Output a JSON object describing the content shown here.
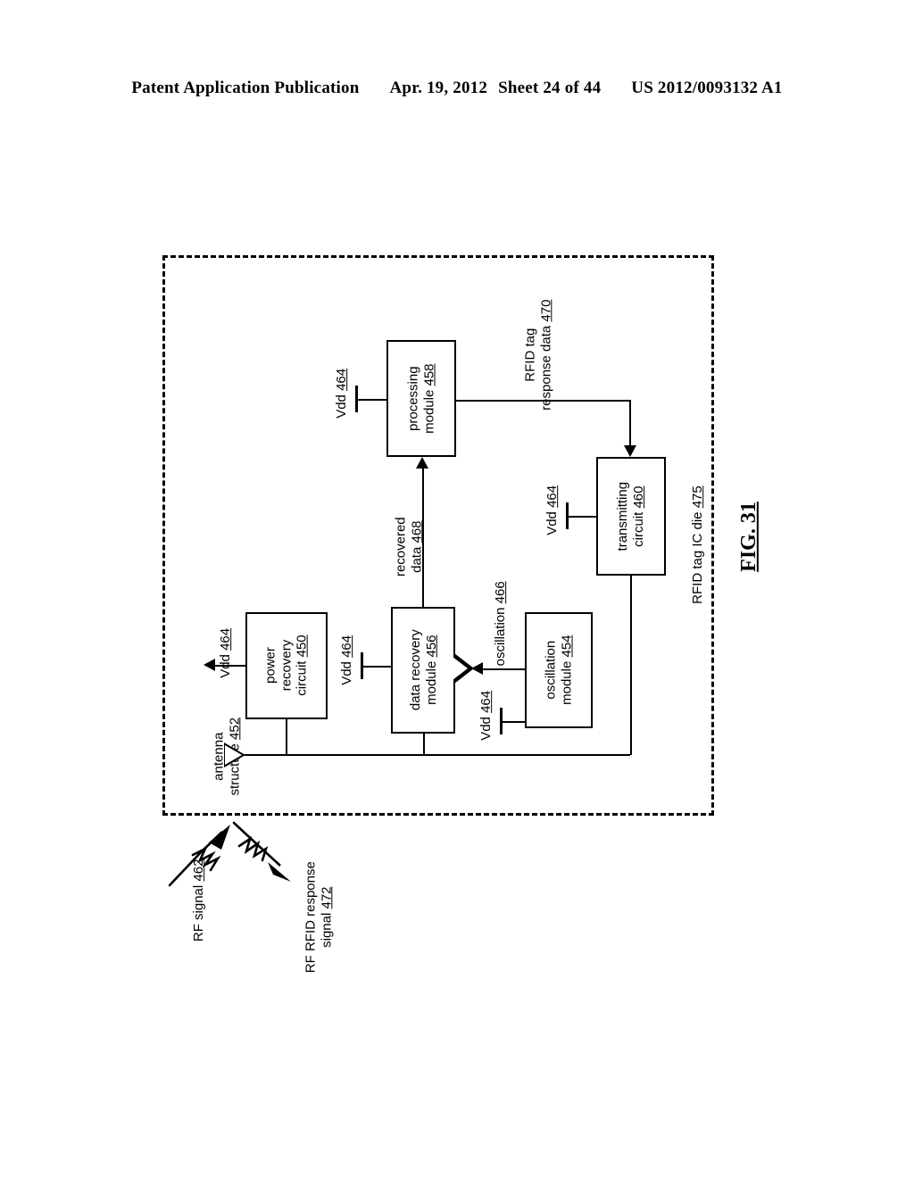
{
  "header": {
    "publication": "Patent Application Publication",
    "date": "Apr. 19, 2012",
    "sheet": "Sheet 24 of 44",
    "number": "US 2012/0093132 A1"
  },
  "figure": {
    "caption": "FIG. 31",
    "boundary_label_text": "RFID tag IC die",
    "boundary_label_ref": "475"
  },
  "blocks": [
    {
      "id": "power-recovery-circuit",
      "line1": "power",
      "line2": "recovery",
      "line3": "circuit",
      "ref": "450"
    },
    {
      "id": "oscillation-module",
      "line1": "oscillation",
      "line2": "module",
      "ref": "454"
    },
    {
      "id": "data-recovery-module",
      "line1": "data recovery",
      "line2": "module",
      "ref": "456"
    },
    {
      "id": "processing-module",
      "line1": "processing",
      "line2": "module",
      "ref": "458"
    },
    {
      "id": "transmitting-circuit",
      "line1": "transmitting",
      "line2": "circuit",
      "ref": "460"
    }
  ],
  "signals": {
    "antenna": {
      "line1": "antenna",
      "line2": "structure",
      "ref": "452"
    },
    "rf_signal": {
      "text": "RF signal",
      "ref": "462"
    },
    "rf_rfid_response": {
      "line1": "RF RFID response",
      "line2": "signal",
      "ref": "472"
    },
    "recovered_data": {
      "line1": "recovered",
      "line2": "data",
      "ref": "468"
    },
    "oscillation": {
      "text": "oscillation",
      "ref": "466"
    },
    "rfid_tag_response_data": {
      "line1": "RFID tag",
      "line2": "response data",
      "ref": "470"
    }
  },
  "supplies": {
    "label": "Vdd",
    "ref": "464",
    "nodes": [
      "power-recovery-output",
      "data-recovery-module",
      "oscillation-module",
      "processing-module",
      "transmitting-circuit"
    ]
  },
  "colors": {
    "ink": "#000000",
    "paper": "#ffffff"
  }
}
